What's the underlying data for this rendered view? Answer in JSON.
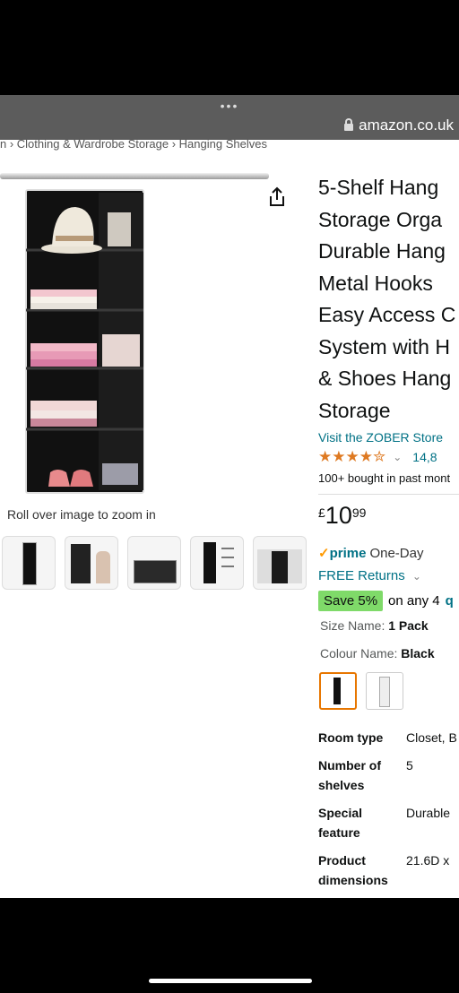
{
  "browser": {
    "dots": "•••",
    "url": "amazon.co.uk"
  },
  "breadcrumb": {
    "text": "n › Clothing & Wardrobe Storage › Hanging Shelves"
  },
  "gallery": {
    "zoom_hint": "Roll over image to zoom in",
    "thumbnail_count": 5
  },
  "product": {
    "title": "5-Shelf Hang\nStorage Orga\nDurable Hang\nMetal Hooks\nEasy Access C\nSystem with H\n& Shoes Hang\nStorage",
    "store_link": "Visit the ZOBER Store",
    "stars_display": "★★★★✮",
    "rating_value": 4.5,
    "rating_count": "14,8",
    "bought_text": "100+ bought in past mont"
  },
  "price": {
    "currency": "£",
    "whole": "10",
    "fraction": "99"
  },
  "delivery": {
    "prime_check": "✓",
    "prime_label": "prime",
    "prime_speed": "One-Day",
    "free_returns": "FREE Returns",
    "save_badge": "Save 5%",
    "save_text": "on any 4",
    "save_tail": "q"
  },
  "variations": {
    "size_label": "Size Name:",
    "size_value": "1 Pack",
    "colour_label": "Colour Name:",
    "colour_value": "Black"
  },
  "specs": [
    {
      "key": "Room type",
      "value": "Closet, B"
    },
    {
      "key": "Number of shelves",
      "value": "5"
    },
    {
      "key": "Special feature",
      "value": "Durable"
    },
    {
      "key": "Product dimensions",
      "value": "21.6D x"
    }
  ],
  "colors": {
    "link": "#007185",
    "accent": "#de7921",
    "save_badge": "#7fda69",
    "url_bar": "#5c5c5c"
  }
}
